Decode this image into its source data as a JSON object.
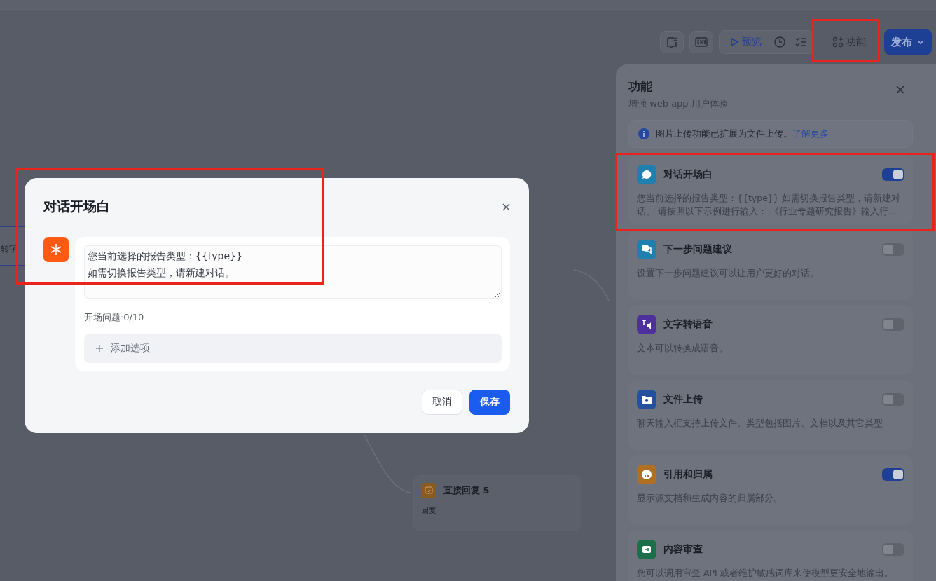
{
  "toolbar": {
    "preview": "预览",
    "features": "功能",
    "publish": "发布"
  },
  "canvas": {
    "nodes": [
      {
        "kind": "partial",
        "title": "转字"
      },
      {
        "kind": "reply",
        "title": "直接回复 5",
        "body": "回复"
      }
    ]
  },
  "features_panel": {
    "title": "功能",
    "subtitle": "增强 web app 用户体验",
    "notice": {
      "text": "图片上传功能已扩展为文件上传。",
      "link": "了解更多"
    },
    "items": [
      {
        "kind": "chat",
        "title": "对话开场白",
        "description": "您当前选择的报告类型：{{type}} 如需切换报告类型，请新建对话。 请按照以下示例进行输入： 《行业专题研究报告》输入行...",
        "on": true,
        "color": "#1f7fae"
      },
      {
        "kind": "suggest",
        "title": "下一步问题建议",
        "description": "设置下一步问题建议可以让用户更好的对话。",
        "on": false,
        "color": "#1f7fae"
      },
      {
        "kind": "speech",
        "title": "文字转语音",
        "description": "文本可以转换成语音。",
        "on": false,
        "color": "#4e2f9e"
      },
      {
        "kind": "upload",
        "title": "文件上传",
        "description": "聊天输入框支持上传文件。类型包括图片、文档以及其它类型",
        "on": false,
        "color": "#24509e"
      },
      {
        "kind": "quote",
        "title": "引用和归属",
        "description": "显示源文档和生成内容的归属部分。",
        "on": true,
        "color": "#b06f22"
      },
      {
        "kind": "review",
        "title": "内容审查",
        "description": "您可以调用审查 API 或者维护敏感词库来使模型更安全地输出。",
        "on": false,
        "color": "#1c6f48"
      }
    ]
  },
  "modal": {
    "title": "对话开场白",
    "opener": "您当前选择的报告类型：{{type}}\n如需切换报告类型，请新建对话。",
    "questions_label": "开场问题·0/10",
    "add_option": "添加选项",
    "cancel": "取消",
    "save": "保存"
  }
}
